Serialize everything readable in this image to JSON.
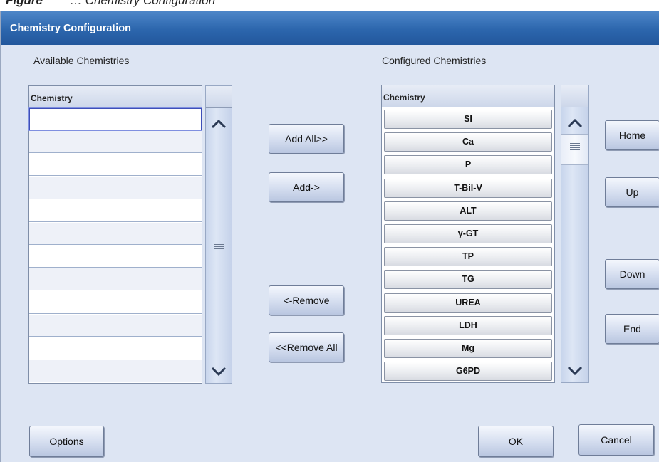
{
  "caption": {
    "figure": "Figure",
    "rest": "… Chemistry Configuration"
  },
  "window": {
    "title": "Chemistry Configuration"
  },
  "available": {
    "label": "Available Chemistries",
    "column_header": "Chemistry",
    "rows": [
      "",
      "",
      "",
      "",
      "",
      "",
      "",
      "",
      "",
      "",
      "",
      ""
    ]
  },
  "configured": {
    "label": "Configured Chemistries",
    "column_header": "Chemistry",
    "items": [
      "SI",
      "Ca",
      "P",
      "T-Bil-V",
      "ALT",
      "γ-GT",
      "TP",
      "TG",
      "UREA",
      "LDH",
      "Mg",
      "G6PD"
    ]
  },
  "transfer_buttons": {
    "add_all": "Add All>>",
    "add": "Add->",
    "remove": "<-Remove",
    "remove_all": "<<Remove All"
  },
  "order_buttons": {
    "home": "Home",
    "up": "Up",
    "down": "Down",
    "end": "End"
  },
  "footer": {
    "options": "Options",
    "ok": "OK",
    "cancel": "Cancel"
  },
  "colors": {
    "title_bar": "#2c66ad",
    "window_bg": "#dde5f3",
    "selection_border": "#3e4fb8"
  }
}
